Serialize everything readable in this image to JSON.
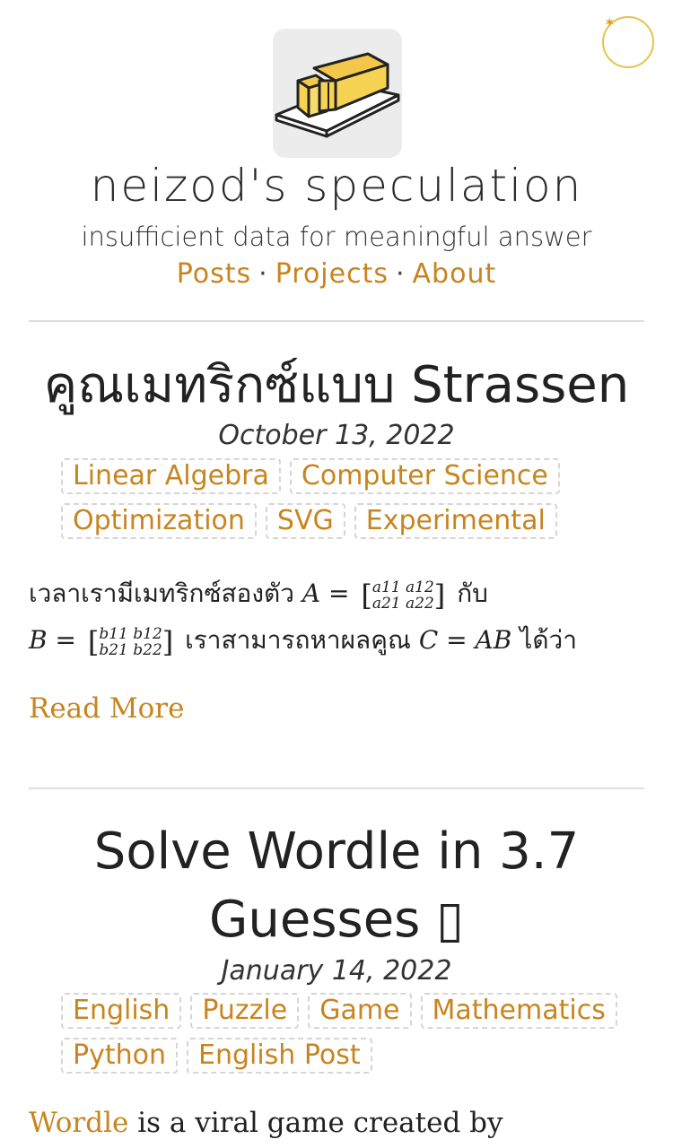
{
  "header": {
    "title": "neizod's speculation",
    "subtitle": "insufficient data for meaningful answer",
    "nav": [
      {
        "label": "Posts"
      },
      {
        "label": "Projects"
      },
      {
        "label": "About"
      }
    ],
    "nav_separator": "·"
  },
  "posts": [
    {
      "title": "คูณเมทริกซ์แบบ Strassen",
      "date": "October 13, 2022",
      "tags": [
        "Linear Algebra",
        "Computer Science",
        "Optimization",
        "SVG",
        "Experimental"
      ],
      "excerpt": {
        "part1": "เวลาเรามีเมทริกซ์สองตัว",
        "A": "A =",
        "matA": [
          "a11",
          "a12",
          "a21",
          "a22"
        ],
        "part2": "กับ",
        "B": "B =",
        "matB": [
          "b11",
          "b12",
          "b21",
          "b22"
        ],
        "part3": "เราสามารถหาผลคูณ",
        "C": "C = AB",
        "part4": "ได้ว่า"
      },
      "read_more": "Read More"
    },
    {
      "title_line1": "Solve Wordle in 3.7",
      "title_line2": "Guesses",
      "title_emoji": "▯",
      "date": "January 14, 2022",
      "tags": [
        "English",
        "Puzzle",
        "Game",
        "Mathematics",
        "Python",
        "English Post"
      ],
      "excerpt": {
        "link": "Wordle",
        "text": " is a viral game created by"
      }
    }
  ],
  "colors": {
    "accent": "#c8841e",
    "toggle_ring": "#e8c24a",
    "divider": "#dedede"
  },
  "icons": {
    "logo": "butter-block-icon",
    "theme_toggle": "sun-moon-toggle-icon"
  }
}
